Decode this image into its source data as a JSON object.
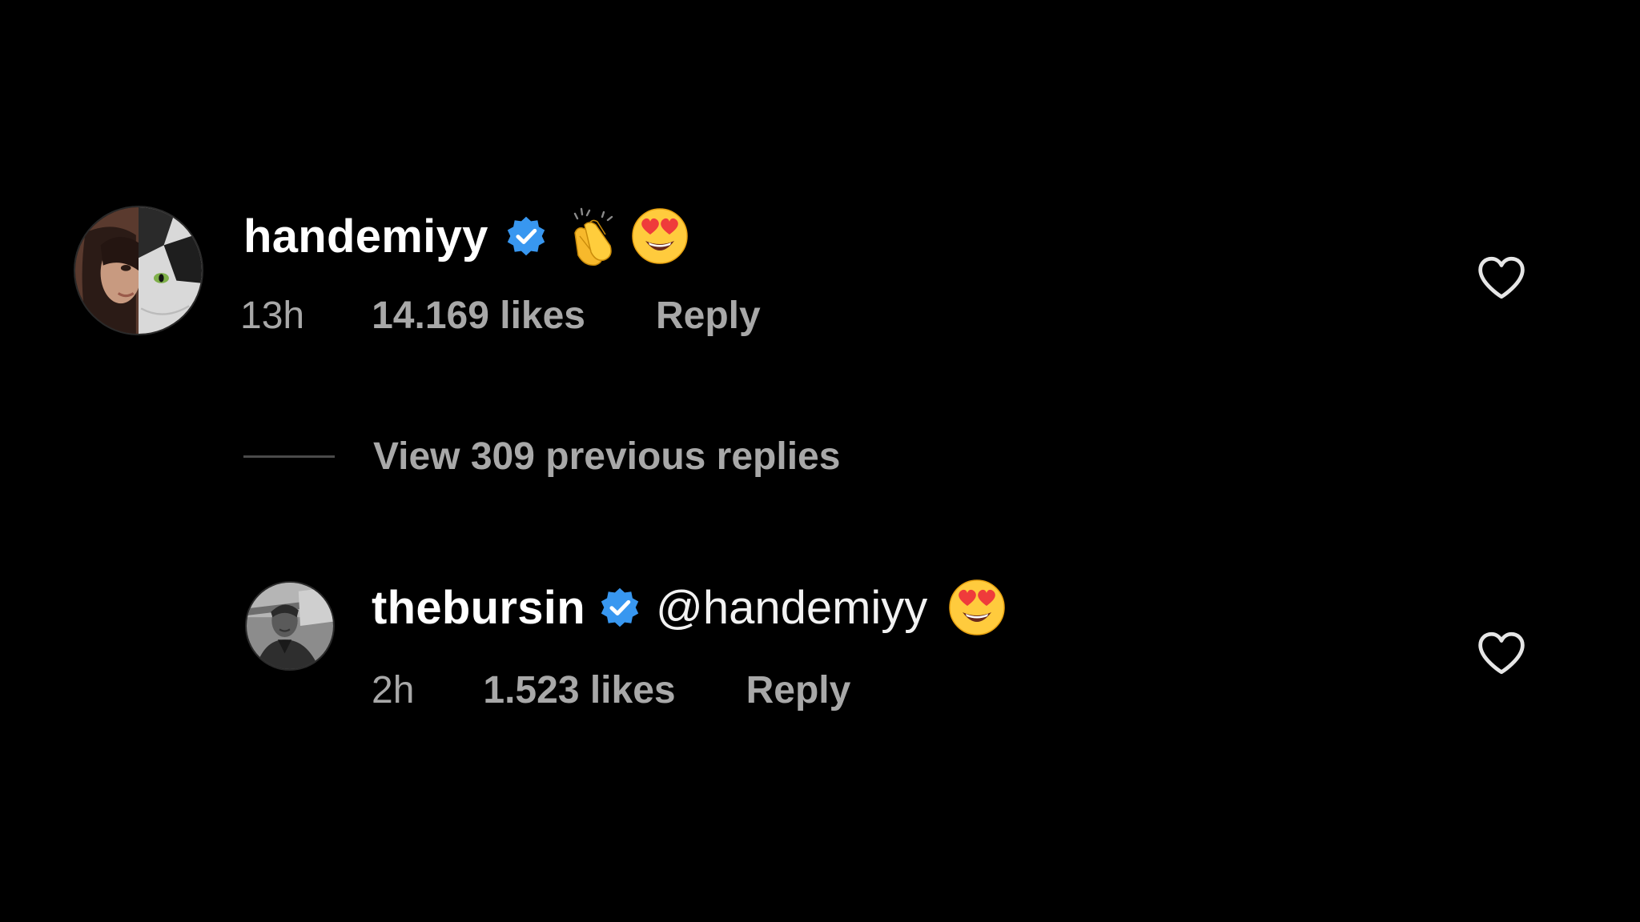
{
  "comments": [
    {
      "username": "handemiyy",
      "verified": true,
      "text": "",
      "emojis": [
        "clapping-hands-emoji",
        "heart-eyes-emoji"
      ],
      "time": "13h",
      "likes": "14.169 likes",
      "reply_label": "Reply",
      "liked": false
    },
    {
      "username": "thebursin",
      "verified": true,
      "text": "@handemiyy",
      "emojis": [
        "heart-eyes-emoji"
      ],
      "time": "2h",
      "likes": "1.523 likes",
      "reply_label": "Reply",
      "liked": false
    }
  ],
  "view_replies": {
    "label": "View 309 previous replies"
  },
  "colors": {
    "background": "#000000",
    "primary_text": "#ffffff",
    "secondary_text": "#a8a8a8",
    "verified_badge": "#3897f0"
  },
  "icons": {
    "like": "heart-outline-icon",
    "verified": "verified-badge-icon"
  }
}
